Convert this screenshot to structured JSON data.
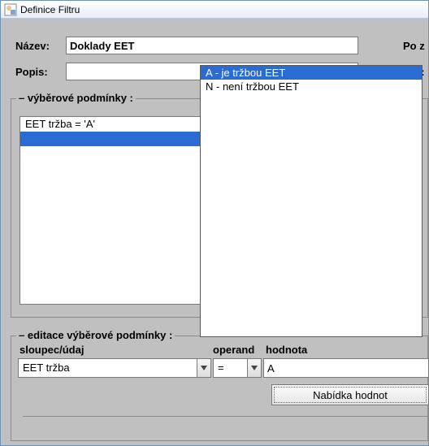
{
  "window": {
    "title": "Definice Filtru"
  },
  "form": {
    "name_label": "Název:",
    "name_value": "Doklady EET",
    "desc_label": "Popis:",
    "desc_value": "",
    "right_frag_1": "Po z",
    "right_frag_2": "e:"
  },
  "group1": {
    "legend": "– výběrové podmínky :",
    "rows": [
      "EET tržba = 'A'",
      ""
    ]
  },
  "group2": {
    "legend": "– editace výběrové podmínky :",
    "col_label": "sloupec/údaj",
    "op_label": "operand",
    "val_label": "hodnota",
    "column_value": "EET tržba",
    "operand_value": "=",
    "value_value": "A",
    "offer_button": "Nabídka hodnot"
  },
  "dropdown": {
    "items": [
      "A - je tržbou EET",
      "N - není tržbou EET"
    ],
    "highlighted": 0
  }
}
